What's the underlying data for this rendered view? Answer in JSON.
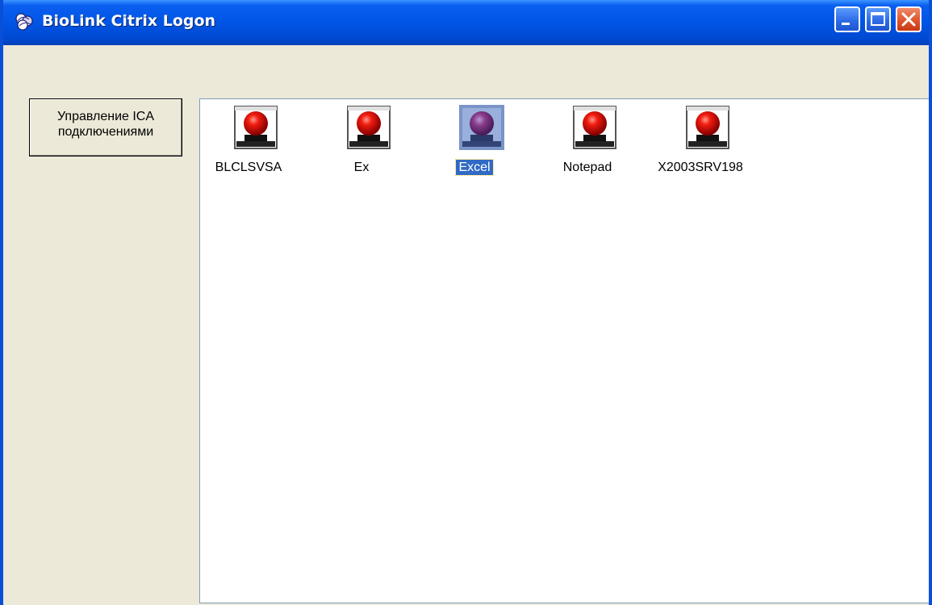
{
  "window": {
    "title": "BioLink Citrix Logon",
    "titlebar_color": "#0055e5",
    "client_bg": "#ece9d8",
    "controls": {
      "minimize": "minimize-icon",
      "maximize": "maximize-icon",
      "close": "close-icon"
    }
  },
  "ica_button": {
    "line1": "Управление ICA",
    "line2": "подключениями"
  },
  "apps": {
    "selected_color": "#316ac5",
    "items": [
      {
        "label": "BLCLSVSA",
        "icon": "citrix-app-icon",
        "selected": false
      },
      {
        "label": "Ex",
        "icon": "citrix-app-icon",
        "selected": false
      },
      {
        "label": "Excel",
        "icon": "citrix-app-icon",
        "selected": true
      },
      {
        "label": "Notepad",
        "icon": "citrix-app-icon",
        "selected": false
      },
      {
        "label": "X2003SRV198",
        "icon": "citrix-app-icon",
        "selected": false
      }
    ]
  }
}
